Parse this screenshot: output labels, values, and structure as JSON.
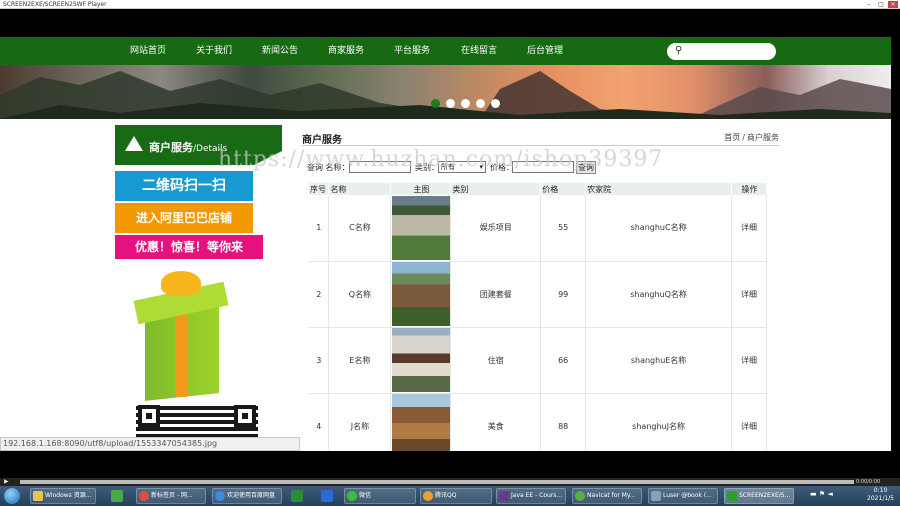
{
  "window": {
    "title": "SCREEN2EXE/SCREEN2SWF Player"
  },
  "nav": {
    "items": [
      "网站首页",
      "关于我们",
      "新闻公告",
      "商家服务",
      "平台服务",
      "在线留言",
      "后台管理"
    ]
  },
  "sidebar": {
    "title": "商户服务",
    "title_suffix": "/Details"
  },
  "promo": {
    "line1": "二维码扫一扫",
    "line2": "进入阿里巴巴店铺",
    "line3": "优惠！惊喜！等你来"
  },
  "watermark": "https://www.huzhan.com/ishop39397",
  "main": {
    "title": "商户服务",
    "breadcrumb": {
      "home": "首页",
      "sep": "/",
      "current": "商户服务"
    }
  },
  "filter": {
    "name_label": "查询 名称：",
    "category_label": "类别：",
    "category_value": "所有",
    "price_label": "价格：",
    "query_button": "查询"
  },
  "table": {
    "headers": [
      "序号",
      "名称",
      "主图",
      "类别",
      "价格",
      "农家院",
      "操作"
    ],
    "rows": [
      {
        "no": "1",
        "name": "C名称",
        "category": "娱乐项目",
        "price": "55",
        "farm": "shanghuC名称",
        "action": "详细"
      },
      {
        "no": "2",
        "name": "Q名称",
        "category": "团建套餐",
        "price": "99",
        "farm": "shanghuQ名称",
        "action": "详细"
      },
      {
        "no": "3",
        "name": "E名称",
        "category": "住宿",
        "price": "66",
        "farm": "shanghuE名称",
        "action": "详细"
      },
      {
        "no": "4",
        "name": "J名称",
        "category": "美食",
        "price": "88",
        "farm": "shanghuJ名称",
        "action": "详细"
      }
    ]
  },
  "status_url": "192.168.1.168:8090/utf8/upload/1553347054385.jpg",
  "player": {
    "controls": "0:00/0:00"
  },
  "taskbar": {
    "items": [
      "Windows 资源...",
      "",
      "新标签页 - 网...",
      "欢迎使用百度网盘",
      "",
      "",
      "微信",
      "腾讯QQ",
      "Java EE - Cours...",
      "Navicat for My...",
      "Luser @book (...",
      "SCREEN2EXE/S..."
    ],
    "clock_time": "0:10",
    "clock_date": "2021/1/5"
  }
}
